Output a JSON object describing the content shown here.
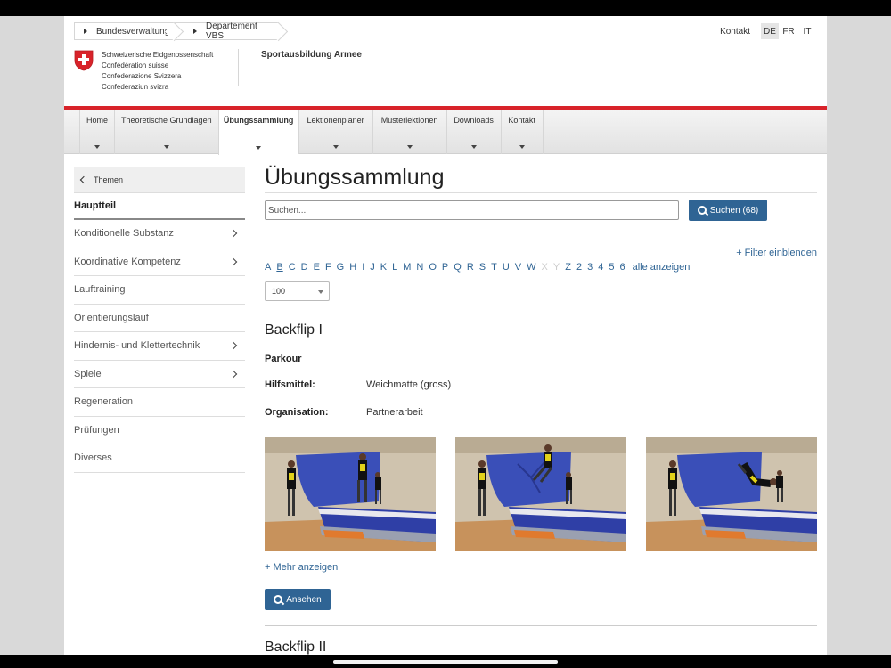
{
  "breadcrumb": [
    "Bundesverwaltung",
    "Departement VBS"
  ],
  "header": {
    "contact": "Kontakt",
    "languages": [
      "DE",
      "FR",
      "IT"
    ],
    "active_language": "DE",
    "org_lines": [
      "Schweizerische Eidgenossenschaft",
      "Confédération suisse",
      "Confederazione Svizzera",
      "Confederaziun svizra"
    ],
    "site_title": "Sportausbildung Armee"
  },
  "nav": [
    {
      "label": "Home",
      "active": false
    },
    {
      "label": "Theoretische Grundlagen",
      "active": false
    },
    {
      "label": "Übungssammlung",
      "active": true
    },
    {
      "label": "Lektionenplaner",
      "active": false
    },
    {
      "label": "Musterlektionen",
      "active": false
    },
    {
      "label": "Downloads",
      "active": false
    },
    {
      "label": "Kontakt",
      "active": false
    }
  ],
  "sidebar": {
    "back": "Themen",
    "current": "Hauptteil",
    "items": [
      {
        "label": "Konditionelle Substanz",
        "has_children": true
      },
      {
        "label": "Koordinative Kompetenz",
        "has_children": true
      },
      {
        "label": "Lauftraining",
        "has_children": false
      },
      {
        "label": "Orientierungslauf",
        "has_children": false
      },
      {
        "label": "Hindernis- und Klettertechnik",
        "has_children": true
      },
      {
        "label": "Spiele",
        "has_children": true
      },
      {
        "label": "Regeneration",
        "has_children": false
      },
      {
        "label": "Prüfungen",
        "has_children": false
      },
      {
        "label": "Diverses",
        "has_children": false
      }
    ]
  },
  "main": {
    "title": "Übungssammlung",
    "search_placeholder": "Suchen...",
    "search_button": "Suchen (68)",
    "filter_link": "+ Filter einblenden",
    "alphabet": [
      "A",
      "B",
      "C",
      "D",
      "E",
      "F",
      "G",
      "H",
      "I",
      "J",
      "K",
      "L",
      "M",
      "N",
      "O",
      "P",
      "Q",
      "R",
      "S",
      "T",
      "U",
      "V",
      "W",
      "X",
      "Y",
      "Z",
      "2",
      "3",
      "4",
      "5",
      "6"
    ],
    "alphabet_disabled": [
      "X",
      "Y"
    ],
    "alphabet_current": "B",
    "show_all": "alle anzeigen",
    "page_size": "100",
    "exercise": {
      "title": "Backflip I",
      "category": "Parkour",
      "fields": [
        {
          "label": "Hilfsmittel:",
          "value": "Weichmatte (gross)"
        },
        {
          "label": "Organisation:",
          "value": "Partnerarbeit"
        }
      ],
      "more": "+ Mehr anzeigen",
      "view_button": "Ansehen"
    },
    "next_exercise_title": "Backflip II"
  },
  "colors": {
    "accent": "#2f6494",
    "swiss_red": "#d8232a"
  }
}
